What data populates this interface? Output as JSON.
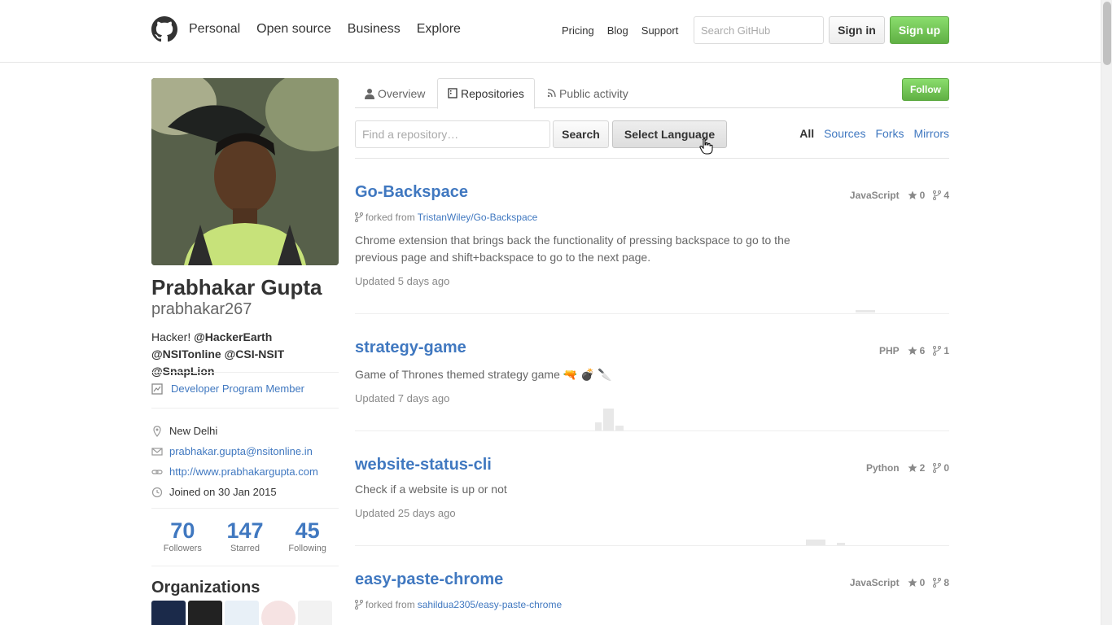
{
  "header": {
    "nav": [
      "Personal",
      "Open source",
      "Business",
      "Explore"
    ],
    "subnav": [
      "Pricing",
      "Blog",
      "Support"
    ],
    "search_placeholder": "Search GitHub",
    "signin": "Sign in",
    "signup": "Sign up"
  },
  "profile": {
    "fullname": "Prabhakar Gupta",
    "username": "prabhakar267",
    "bio_prefix": "Hacker! ",
    "bio_handles": "@HackerEarth @NSITonline @CSI-NSIT @SnapLion",
    "badge": "Developer Program Member",
    "location": "New Delhi",
    "email": "prabhakar.gupta@nsitonline.in",
    "website": "http://www.prabhakargupta.com",
    "joined": "Joined on 30 Jan 2015",
    "stats": [
      {
        "num": "70",
        "label": "Followers"
      },
      {
        "num": "147",
        "label": "Starred"
      },
      {
        "num": "45",
        "label": "Following"
      }
    ],
    "orgs_title": "Organizations"
  },
  "tabs": {
    "overview": "Overview",
    "repositories": "Repositories",
    "activity": "Public activity"
  },
  "follow": "Follow",
  "filter": {
    "search_placeholder": "Find a repository…",
    "search_button": "Search",
    "language_button": "Select Language",
    "types": [
      "All",
      "Sources",
      "Forks",
      "Mirrors"
    ]
  },
  "repos": [
    {
      "name": "Go-Backspace",
      "language": "JavaScript",
      "stars": "0",
      "forks": "4",
      "forked_prefix": "forked from ",
      "forked_from": "TristanWiley/Go-Backspace",
      "description": "Chrome extension that brings back the functionality of pressing backspace to go to the previous page and shift+backspace to go to the next page.",
      "updated": "Updated 5 days ago"
    },
    {
      "name": "strategy-game",
      "language": "PHP",
      "stars": "6",
      "forks": "1",
      "description": "Game of Thrones themed strategy game 🔫 💣 🔪",
      "updated": "Updated 7 days ago"
    },
    {
      "name": "website-status-cli",
      "language": "Python",
      "stars": "2",
      "forks": "0",
      "description": "Check if a website is up or not",
      "updated": "Updated 25 days ago"
    },
    {
      "name": "easy-paste-chrome",
      "language": "JavaScript",
      "stars": "0",
      "forks": "8",
      "forked_prefix": "forked from ",
      "forked_from": "sahildua2305/easy-paste-chrome"
    }
  ]
}
